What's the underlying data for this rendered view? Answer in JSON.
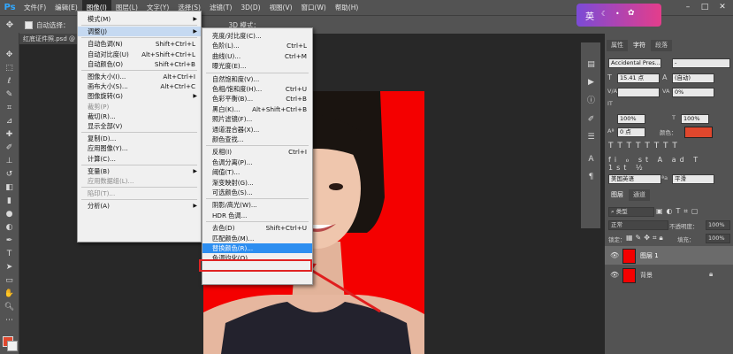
{
  "app": {
    "logo": "Ps"
  },
  "menubar": {
    "items": [
      "文件(F)",
      "编辑(E)",
      "图像(I)",
      "图层(L)",
      "文字(Y)",
      "选择(S)",
      "滤镜(T)",
      "3D(D)",
      "视图(V)",
      "窗口(W)",
      "帮助(H)"
    ],
    "active_index": 2
  },
  "options": {
    "auto_select_label": "自动选择：",
    "mode_3d_label": "3D 模式："
  },
  "document": {
    "tab_title": "红底证件照.psd @"
  },
  "image_menu": {
    "items": [
      {
        "label": "模式(M)",
        "shortcut": "",
        "submenu": true,
        "disabled": false
      },
      {
        "sep": true
      },
      {
        "label": "调整(J)",
        "shortcut": "",
        "submenu": true,
        "disabled": false,
        "highlight": true
      },
      {
        "sep": true
      },
      {
        "label": "自动色调(N)",
        "shortcut": "Shift+Ctrl+L",
        "submenu": false,
        "disabled": false
      },
      {
        "label": "自动对比度(U)",
        "shortcut": "Alt+Shift+Ctrl+L",
        "submenu": false,
        "disabled": false
      },
      {
        "label": "自动颜色(O)",
        "shortcut": "Shift+Ctrl+B",
        "submenu": false,
        "disabled": false
      },
      {
        "sep": true
      },
      {
        "label": "图像大小(I)...",
        "shortcut": "Alt+Ctrl+I",
        "submenu": false,
        "disabled": false
      },
      {
        "label": "画布大小(S)...",
        "shortcut": "Alt+Ctrl+C",
        "submenu": false,
        "disabled": false
      },
      {
        "label": "图像旋转(G)",
        "shortcut": "",
        "submenu": true,
        "disabled": false
      },
      {
        "label": "裁剪(P)",
        "shortcut": "",
        "submenu": false,
        "disabled": true
      },
      {
        "label": "裁切(R)...",
        "shortcut": "",
        "submenu": false,
        "disabled": false
      },
      {
        "label": "显示全部(V)",
        "shortcut": "",
        "submenu": false,
        "disabled": false
      },
      {
        "sep": true
      },
      {
        "label": "复制(D)...",
        "shortcut": "",
        "submenu": false,
        "disabled": false
      },
      {
        "label": "应用图像(Y)...",
        "shortcut": "",
        "submenu": false,
        "disabled": false
      },
      {
        "label": "计算(C)...",
        "shortcut": "",
        "submenu": false,
        "disabled": false
      },
      {
        "sep": true
      },
      {
        "label": "变量(B)",
        "shortcut": "",
        "submenu": true,
        "disabled": false
      },
      {
        "label": "应用数据组(L)...",
        "shortcut": "",
        "submenu": false,
        "disabled": true
      },
      {
        "sep": true
      },
      {
        "label": "陷印(T)...",
        "shortcut": "",
        "submenu": false,
        "disabled": true
      },
      {
        "sep": true
      },
      {
        "label": "分析(A)",
        "shortcut": "",
        "submenu": true,
        "disabled": false
      }
    ]
  },
  "adjust_menu": {
    "items": [
      {
        "label": "亮度/对比度(C)...",
        "shortcut": ""
      },
      {
        "label": "色阶(L)...",
        "shortcut": "Ctrl+L"
      },
      {
        "label": "曲线(U)...",
        "shortcut": "Ctrl+M"
      },
      {
        "label": "曝光度(E)...",
        "shortcut": ""
      },
      {
        "sep": true
      },
      {
        "label": "自然饱和度(V)...",
        "shortcut": ""
      },
      {
        "label": "色相/饱和度(H)...",
        "shortcut": "Ctrl+U"
      },
      {
        "label": "色彩平衡(B)...",
        "shortcut": "Ctrl+B"
      },
      {
        "label": "黑白(K)...",
        "shortcut": "Alt+Shift+Ctrl+B"
      },
      {
        "label": "照片滤镜(F)...",
        "shortcut": ""
      },
      {
        "label": "通道混合器(X)...",
        "shortcut": ""
      },
      {
        "label": "颜色查找...",
        "shortcut": ""
      },
      {
        "sep": true
      },
      {
        "label": "反相(I)",
        "shortcut": "Ctrl+I"
      },
      {
        "label": "色调分离(P)...",
        "shortcut": ""
      },
      {
        "label": "阈值(T)...",
        "shortcut": ""
      },
      {
        "label": "渐变映射(G)...",
        "shortcut": ""
      },
      {
        "label": "可选颜色(S)...",
        "shortcut": ""
      },
      {
        "sep": true
      },
      {
        "label": "阴影/高光(W)...",
        "shortcut": ""
      },
      {
        "label": "HDR 色调...",
        "shortcut": ""
      },
      {
        "sep": true
      },
      {
        "label": "去色(D)",
        "shortcut": "Shift+Ctrl+U"
      },
      {
        "label": "匹配颜色(M)...",
        "shortcut": ""
      },
      {
        "label": "替换颜色(R)...",
        "shortcut": "",
        "selected": true
      },
      {
        "label": "色调均化(Q)",
        "shortcut": ""
      }
    ]
  },
  "character_panel": {
    "tabs": [
      "属性",
      "字符",
      "段落"
    ],
    "active_tab": 1,
    "font_family": "Accidental Pres...",
    "font_style": "-",
    "font_size": "15.41 点",
    "leading": "(自动)",
    "kerning": "",
    "tracking": "0%",
    "vscale": "100%",
    "hscale": "100%",
    "baseline": "0 点",
    "color_label": "颜色：",
    "color_value": "#e0472d",
    "language": "美国英语",
    "antialias": "平滑"
  },
  "layers_panel": {
    "tabs": [
      "图层",
      "通道"
    ],
    "active_tab": 0,
    "filter_label": "类型",
    "blend_mode": "正常",
    "opacity_label": "不透明度：",
    "opacity": "100%",
    "lock_label": "锁定：",
    "fill_label": "填充：",
    "fill": "100%",
    "layers": [
      {
        "name": "图层 1",
        "selected": true
      },
      {
        "name": "背景",
        "selected": false,
        "locked": true
      }
    ]
  },
  "ime": {
    "label": "英"
  }
}
